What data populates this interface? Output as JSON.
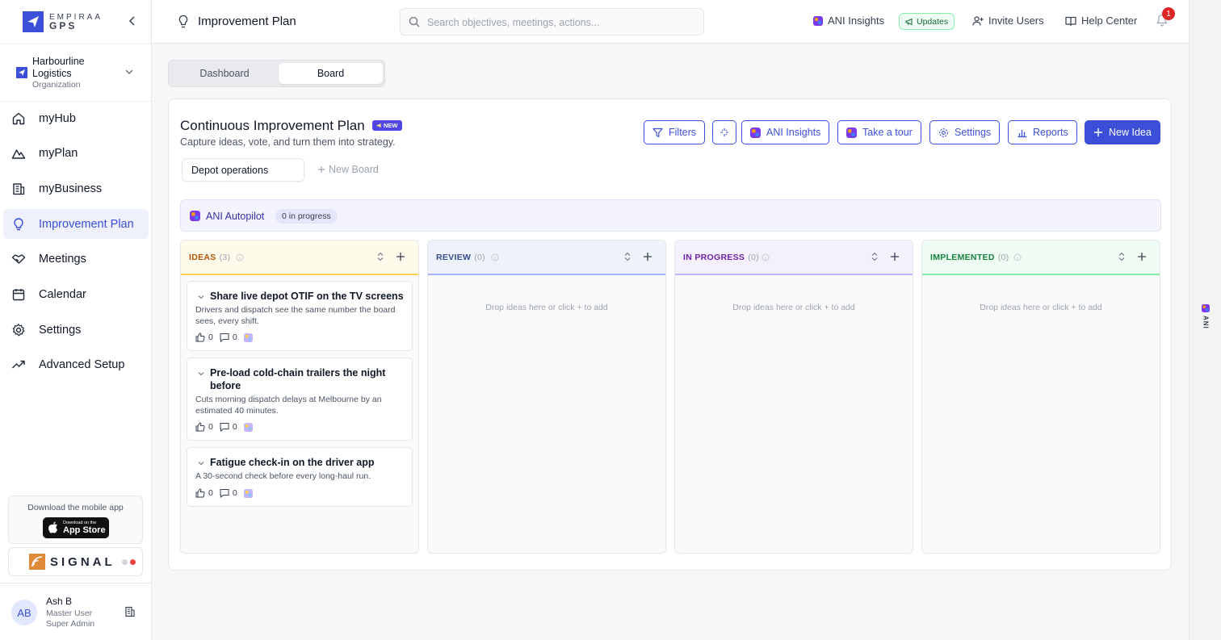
{
  "brand": {
    "line1": "EMPIRAA",
    "line2": "GPS"
  },
  "org": {
    "name": "Harbourline Logistics",
    "type": "Organization"
  },
  "nav": [
    {
      "label": "myHub",
      "icon": "home-icon"
    },
    {
      "label": "myPlan",
      "icon": "mountain-icon"
    },
    {
      "label": "myBusiness",
      "icon": "building-icon"
    },
    {
      "label": "Improvement Plan",
      "icon": "lightbulb-icon",
      "active": true
    },
    {
      "label": "Meetings",
      "icon": "handshake-icon"
    },
    {
      "label": "Calendar",
      "icon": "calendar-icon"
    },
    {
      "label": "Settings",
      "icon": "gear-icon"
    },
    {
      "label": "Advanced Setup",
      "icon": "trending-icon"
    }
  ],
  "app_download": {
    "title": "Download the mobile app",
    "store_small": "Download on the",
    "store_large": "App Store"
  },
  "signal": {
    "label": "SIGNAL"
  },
  "user": {
    "initials": "AB",
    "name": "Ash B",
    "role": "Master User",
    "role2": "Super Admin"
  },
  "header": {
    "title": "Improvement Plan",
    "search_placeholder": "Search objectives, meetings, actions...",
    "ani_insights": "ANI Insights",
    "updates": "Updates",
    "invite": "Invite Users",
    "help": "Help Center",
    "notifications": "1"
  },
  "view_toggle": {
    "dashboard": "Dashboard",
    "board": "Board",
    "selected": "Board"
  },
  "plan": {
    "title": "Continuous Improvement Plan",
    "badge": "NEW",
    "subtitle": "Capture ideas, vote, and turn them into strategy.",
    "toolbar": {
      "filters": "Filters",
      "ani": "ANI Insights",
      "tour": "Take a tour",
      "settings": "Settings",
      "reports": "Reports",
      "new_idea": "New Idea"
    },
    "board_tab": "Depot operations",
    "new_board": "New Board",
    "autopilot": {
      "label": "ANI Autopilot",
      "status": "0 in progress"
    }
  },
  "columns": [
    {
      "name": "IDEAS",
      "count": "(3)",
      "color": "#b45309",
      "bg": "#fffbeb",
      "line": "#fcd34d",
      "empty": ""
    },
    {
      "name": "REVIEW",
      "count": "(0)",
      "color": "#374b8f",
      "bg": "#eef2fb",
      "line": "#a5b4fc",
      "empty": "Drop ideas here or click + to add"
    },
    {
      "name": "IN PROGRESS",
      "count": "(0)",
      "color": "#6b21a8",
      "bg": "#f5f0fd",
      "line": "#c4b5fd",
      "empty": "Drop ideas here or click + to add"
    },
    {
      "name": "IMPLEMENTED",
      "count": "(0)",
      "color": "#15803d",
      "bg": "#effcf3",
      "line": "#86efac",
      "empty": "Drop ideas here or click + to add"
    }
  ],
  "ideas": [
    {
      "title": "Share live depot OTIF on the TV screens",
      "desc": "Drivers and dispatch see the same number the board sees, every shift.",
      "likes": "0",
      "comments": "0"
    },
    {
      "title": "Pre-load cold-chain trailers the night before",
      "desc": "Cuts morning dispatch delays at Melbourne by an estimated 40 minutes.",
      "likes": "0",
      "comments": "0"
    },
    {
      "title": "Fatigue check-in on the driver app",
      "desc": "A 30-second check before every long-haul run.",
      "likes": "0",
      "comments": "0"
    }
  ],
  "rail": {
    "label": "ANI"
  }
}
